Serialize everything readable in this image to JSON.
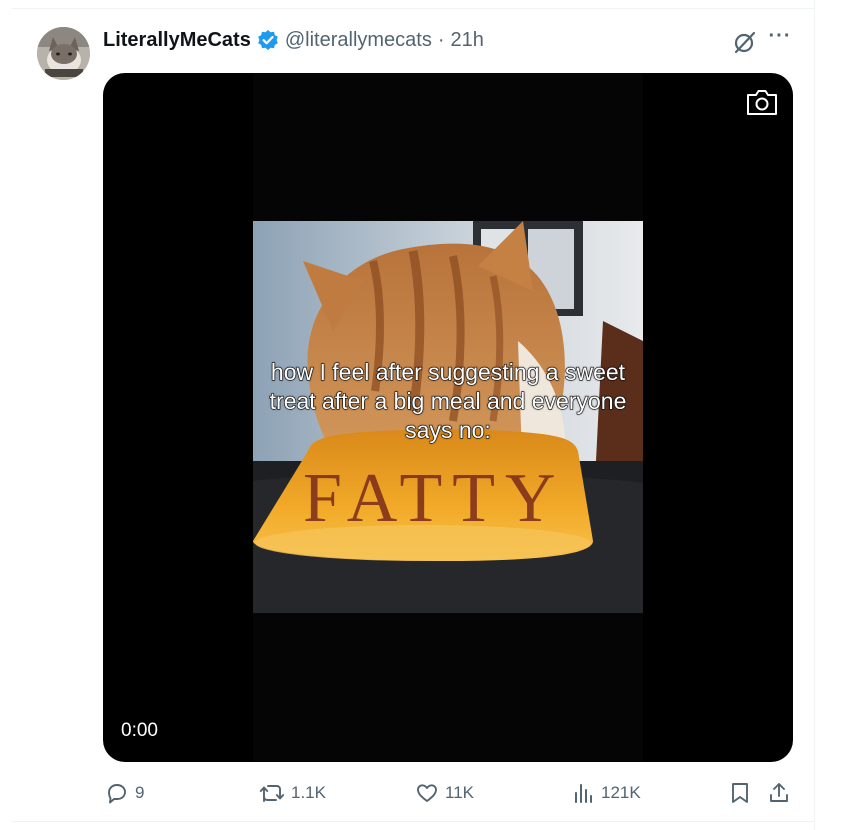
{
  "post": {
    "display_name": "LiterallyMeCats",
    "handle": "@literallymecats",
    "separator": "·",
    "time": "21h",
    "more_label": "···"
  },
  "media": {
    "caption": "how I feel after suggesting a sweet treat after a big meal and everyone says no:",
    "bowl_text": "FATTY",
    "timecode": "0:00"
  },
  "actions": {
    "replies": "9",
    "reposts": "1.1K",
    "likes": "11K",
    "views": "121K"
  },
  "icons": {
    "verified": "verified-badge-icon",
    "grok": "grok-icon",
    "camera": "camera-icon",
    "reply": "reply-icon",
    "repost": "repost-icon",
    "like": "heart-icon",
    "views": "views-chart-icon",
    "bookmark": "bookmark-icon",
    "share": "share-icon"
  },
  "colors": {
    "text_primary": "#0f1419",
    "text_secondary": "#536471",
    "verified_blue": "#1d9bf0",
    "divider": "#eff3f4",
    "media_bg": "#000000",
    "bowl_orange": "#f0a821"
  }
}
